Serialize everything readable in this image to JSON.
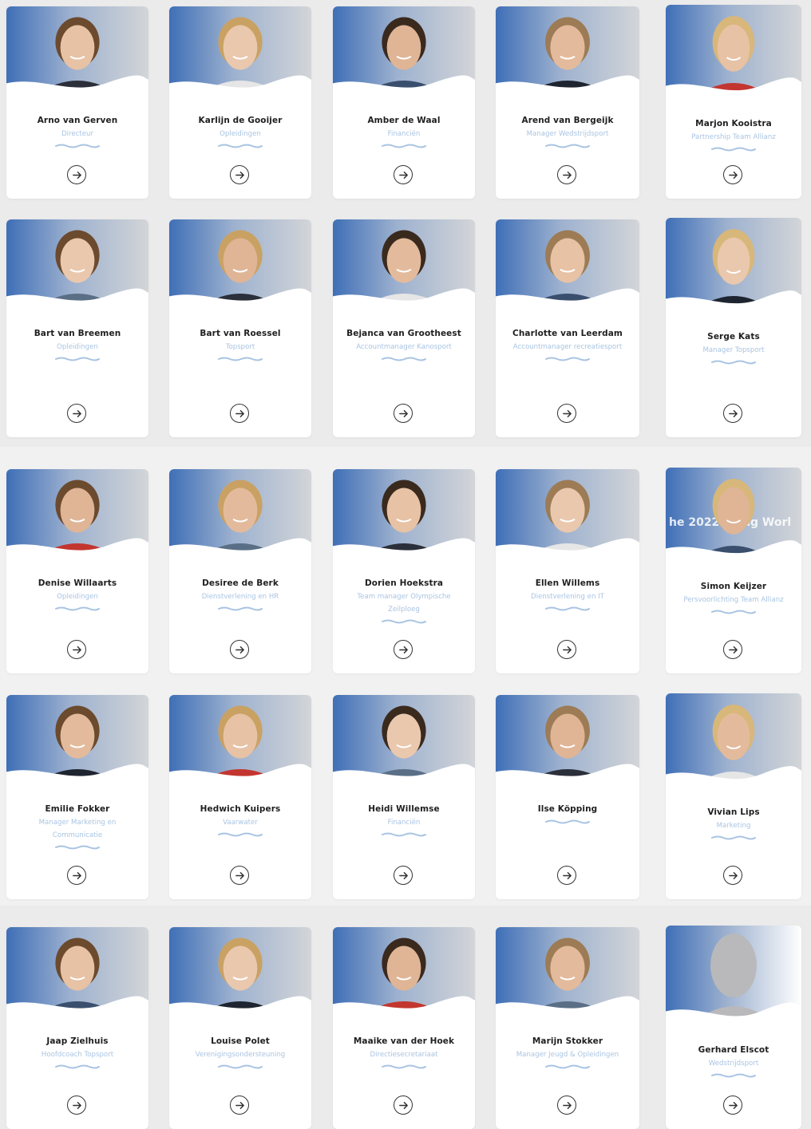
{
  "colors": {
    "page_background": "#ebebeb",
    "card_background": "#ffffff",
    "photo_blue": "#3f6fb7",
    "photo_grey": "#d3d5d8",
    "name_text": "#1f1f1f",
    "role_text": "#a9c4e2",
    "squiggle": "#a9c4e2",
    "arrow": "#333333"
  },
  "icons": {
    "card_button": "arrow-right-circle-icon",
    "wave_divider": "wave-divider-icon"
  },
  "team": [
    {
      "name": "Arno van Gerven",
      "role": "Directeur"
    },
    {
      "name": "Karlijn de Gooijer",
      "role": "Opleidingen"
    },
    {
      "name": "Amber de Waal",
      "role": "Financiën"
    },
    {
      "name": "Arend van Bergeijk",
      "role": "Manager Wedstrijdsport"
    },
    {
      "name": "Marjon Kooistra",
      "role": "Partnership Team Allianz"
    },
    {
      "name": "Bart van Breemen",
      "role": "Opleidingen"
    },
    {
      "name": "Bart van Roessel",
      "role": "Topsport"
    },
    {
      "name": "Bejanca van Grootheest",
      "role": "Accountmanager Kanosport"
    },
    {
      "name": "Charlotte van Leerdam",
      "role": "Accountmanager recreatiesport"
    },
    {
      "name": "Serge Kats",
      "role": "Manager Topsport"
    },
    {
      "name": "Denise Willaarts",
      "role": "Opleidingen"
    },
    {
      "name": "Desiree de Berk",
      "role": "Dienstverlening en HR"
    },
    {
      "name": "Dorien Hoekstra",
      "role": "Team manager Olympische Zeilploeg"
    },
    {
      "name": "Ellen Willems",
      "role": "Dienstverlening en IT"
    },
    {
      "name": "Simon Keijzer",
      "role": "Persvoorlichting Team Allianz",
      "photo_text": "he 2022 ailing Worl"
    },
    {
      "name": "Emilie Fokker",
      "role": "Manager Marketing en Communicatie"
    },
    {
      "name": "Hedwich Kuipers",
      "role": "Vaarwater"
    },
    {
      "name": "Heidi Willemse",
      "role": "Financiën"
    },
    {
      "name": "Ilse Köpping",
      "role": ""
    },
    {
      "name": "Vivian Lips",
      "role": "Marketing"
    },
    {
      "name": "Jaap Zielhuis",
      "role": "Hoofdcoach Topsport"
    },
    {
      "name": "Louise Polet",
      "role": "Verenigingsondersteuning"
    },
    {
      "name": "Maaike van der Hoek",
      "role": "Directiesecretariaat"
    },
    {
      "name": "Marijn Stokker",
      "role": "Manager Jeugd & Opleidingen"
    },
    {
      "name": "Gerhard Elscot",
      "role": "Wedstrijdsport"
    }
  ]
}
